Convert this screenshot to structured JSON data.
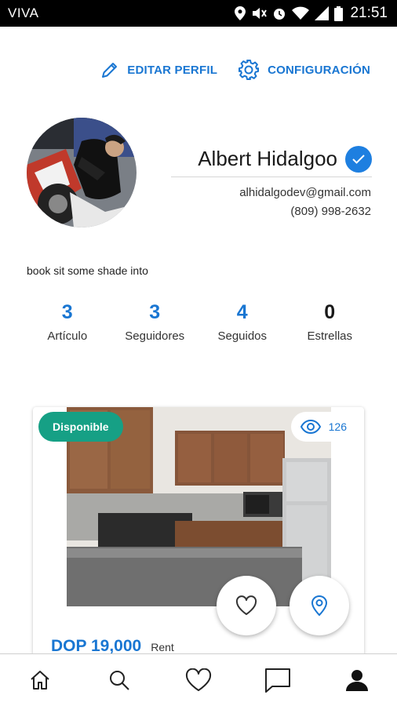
{
  "status_bar": {
    "carrier": "VIVA",
    "time": "21:51"
  },
  "header_actions": {
    "edit_profile": "EDITAR PERFIL",
    "settings": "CONFIGURACIÓN"
  },
  "profile": {
    "name": "Albert Hidalgoo",
    "verified": true,
    "email": "alhidalgodev@gmail.com",
    "phone": "(809) 998-2632",
    "bio": "book sit some shade into"
  },
  "stats": [
    {
      "value": "3",
      "label": "Artículo"
    },
    {
      "value": "3",
      "label": "Seguidores"
    },
    {
      "value": "4",
      "label": "Seguidos"
    },
    {
      "value": "0",
      "label": "Estrellas"
    }
  ],
  "listing": {
    "status": "Disponible",
    "views": "126",
    "price": "DOP 19,000",
    "type": "Rent"
  },
  "colors": {
    "accent": "#1976d2",
    "badge": "#16a085",
    "status_bar": "#000000"
  },
  "bottom_nav": [
    "home-icon",
    "search-icon",
    "heart-icon",
    "chat-icon",
    "profile-icon"
  ]
}
